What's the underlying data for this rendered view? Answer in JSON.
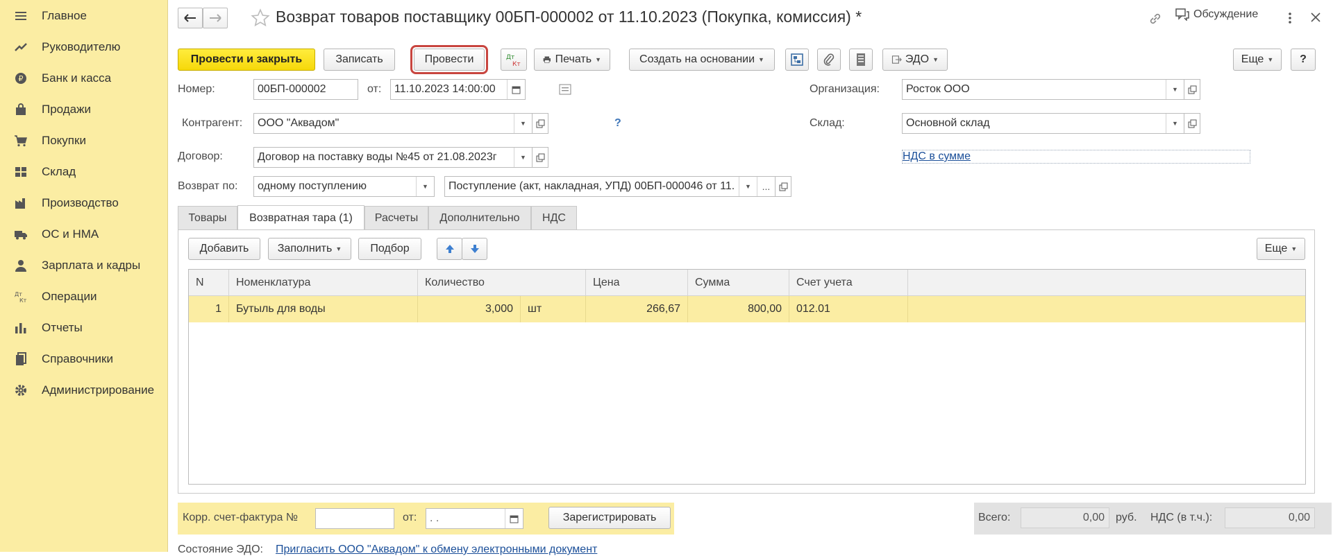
{
  "sidebar": {
    "items": [
      {
        "label": "Главное",
        "icon": "hamburger-icon"
      },
      {
        "label": "Руководителю",
        "icon": "trend-icon"
      },
      {
        "label": "Банк и касса",
        "icon": "ruble-coin-icon"
      },
      {
        "label": "Продажи",
        "icon": "shopping-bag-icon"
      },
      {
        "label": "Покупки",
        "icon": "cart-icon"
      },
      {
        "label": "Склад",
        "icon": "warehouse-icon"
      },
      {
        "label": "Производство",
        "icon": "factory-icon"
      },
      {
        "label": "ОС и НМА",
        "icon": "truck-icon"
      },
      {
        "label": "Зарплата и кадры",
        "icon": "person-icon"
      },
      {
        "label": "Операции",
        "icon": "dt-kt-icon"
      },
      {
        "label": "Отчеты",
        "icon": "bar-chart-icon"
      },
      {
        "label": "Справочники",
        "icon": "books-icon"
      },
      {
        "label": "Администрирование",
        "icon": "gear-icon"
      }
    ]
  },
  "header": {
    "title": "Возврат товаров поставщику 00БП-000002 от 11.10.2023 (Покупка, комиссия) *",
    "discussion": "Обсуждение"
  },
  "toolbar": {
    "post_close": "Провести и закрыть",
    "save": "Записать",
    "post": "Провести",
    "dtkt_top": "Дт",
    "dtkt_bottom": "Кт",
    "print": "Печать",
    "create_based": "Создать на основании",
    "edo": "ЭДО",
    "more": "Еще",
    "help": "?"
  },
  "form": {
    "number_label": "Номер:",
    "number_value": "00БП-000002",
    "date_label": "от:",
    "date_value": "11.10.2023 14:00:00",
    "org_label": "Организация:",
    "org_value": "Росток ООО",
    "counterparty_label": "Контрагент:",
    "counterparty_value": "ООО \"Аквадом\"",
    "counterparty_help": "?",
    "warehouse_label": "Склад:",
    "warehouse_value": "Основной склад",
    "contract_label": "Договор:",
    "contract_value": "Договор на поставку воды №45 от 21.08.2023г",
    "vat_link": "НДС в сумме",
    "return_by_label": "Возврат по:",
    "return_by_value": "одному поступлению",
    "receipt_value": "Поступление (акт, накладная, УПД) 00БП-000046 от 11.",
    "receipt_ellipsis": "..."
  },
  "tabs": [
    {
      "label": "Товары",
      "active": false
    },
    {
      "label": "Возвратная тара (1)",
      "active": true
    },
    {
      "label": "Расчеты",
      "active": false
    },
    {
      "label": "Дополнительно",
      "active": false
    },
    {
      "label": "НДС",
      "active": false
    }
  ],
  "table_toolbar": {
    "add": "Добавить",
    "fill": "Заполнить",
    "select": "Подбор",
    "more": "Еще"
  },
  "table": {
    "columns": [
      "N",
      "Номенклатура",
      "Количество",
      "Цена",
      "Сумма",
      "Счет учета"
    ],
    "rows": [
      {
        "n": "1",
        "item": "Бутыль для воды",
        "qty": "3,000",
        "unit": "шт",
        "price": "266,67",
        "sum": "800,00",
        "account": "012.01"
      }
    ]
  },
  "footer": {
    "corr_invoice_label": "Корр. счет-фактура №",
    "corr_invoice_value": "",
    "date_label": "от:",
    "date_value": " .  .",
    "register": "Зарегистрировать",
    "total_label": "Всего:",
    "total_value": "0,00",
    "currency": "руб.",
    "vat_label": "НДС (в т.ч.):",
    "vat_value": "0,00",
    "edo_status_label": "Состояние ЭДО:",
    "edo_status_link": "Пригласить ООО \"Аквадом\" к обмену электронными документ"
  },
  "colors": {
    "sidebar_bg": "#fbeda3",
    "primary_button": "#f6d80a",
    "highlight_outline": "#c8453f",
    "link": "#1b4f99"
  }
}
